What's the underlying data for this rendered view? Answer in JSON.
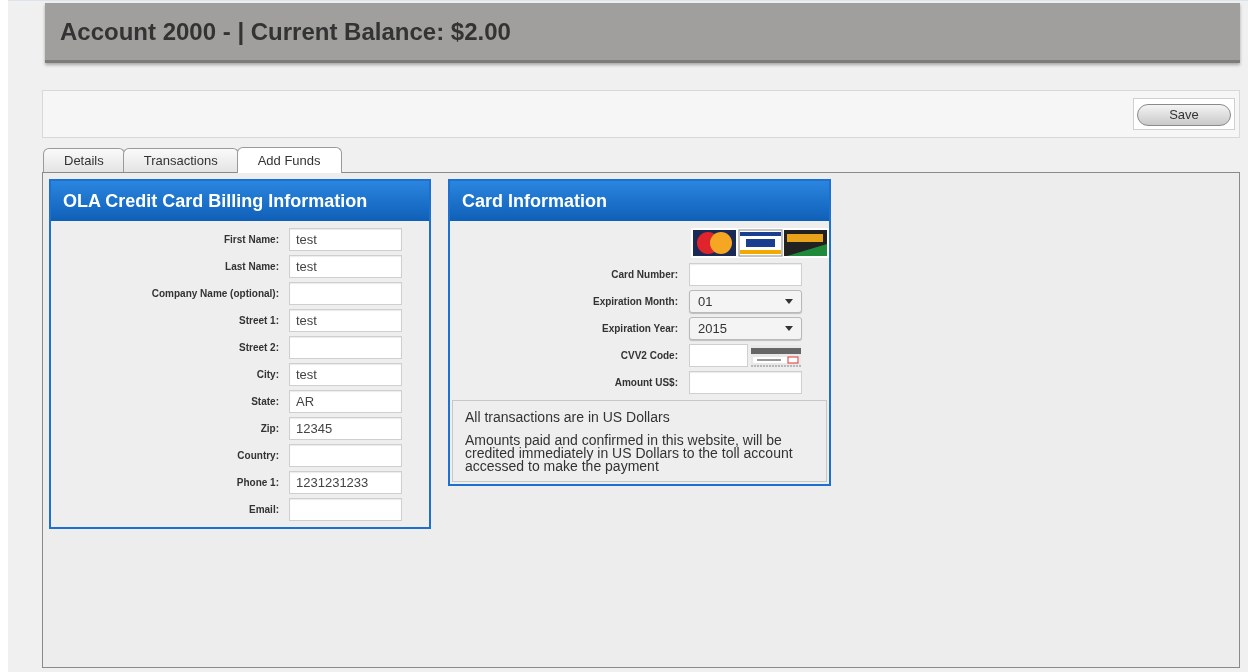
{
  "header": {
    "title": "Account 2000 - | Current Balance: $2.00"
  },
  "toolbar": {
    "save_button": "Save"
  },
  "tabs": [
    {
      "label": "Details",
      "selected": false
    },
    {
      "label": "Transactions",
      "selected": false
    },
    {
      "label": "Add Funds",
      "selected": true
    }
  ],
  "billing_panel": {
    "title": "OLA Credit Card Billing Information",
    "fields": [
      {
        "label": "First Name:",
        "value": "test"
      },
      {
        "label": "Last Name:",
        "value": "test"
      },
      {
        "label": "Company Name (optional):"
      },
      {
        "label": "Street 1:",
        "value": "test"
      },
      {
        "label": "Street 2:"
      },
      {
        "label": "City:",
        "value": "test"
      },
      {
        "label": "State:",
        "value": "AR"
      },
      {
        "label": "Zip:",
        "value": "12345"
      },
      {
        "label": "Country:"
      },
      {
        "label": "Phone 1:",
        "value": "1231231233"
      },
      {
        "label": "Email:"
      }
    ]
  },
  "card_panel": {
    "title": "Card Information",
    "fields": [
      {
        "kind": "input",
        "label": "Card Number:"
      },
      {
        "kind": "select",
        "label": "Expiration Month:",
        "value": "01"
      },
      {
        "kind": "select",
        "label": "Expiration Year:",
        "value": "2015"
      },
      {
        "kind": "cvv",
        "label": "CVV2 Code:"
      },
      {
        "kind": "input",
        "label": "Amount US$:"
      }
    ],
    "notes": [
      "All transactions are in US Dollars",
      "Amounts paid and confirmed in this website, will be credited immediately in US Dollars to the toll account accessed to make the payment"
    ]
  }
}
